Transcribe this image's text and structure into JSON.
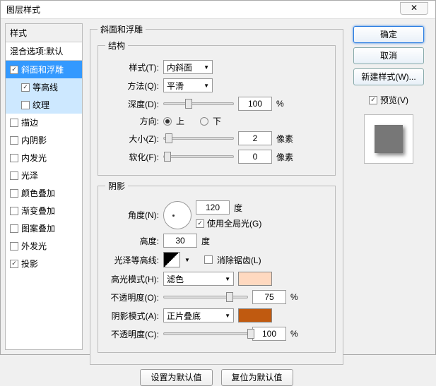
{
  "title": "图层样式",
  "left": {
    "header": "样式",
    "sub": "混合选项:默认",
    "items": [
      {
        "label": "斜面和浮雕",
        "checked": true,
        "selected": "sel"
      },
      {
        "label": "等高线",
        "checked": true,
        "indent": true,
        "selected": "sub-sel"
      },
      {
        "label": "纹理",
        "checked": false,
        "indent": true,
        "selected": "sub-sel"
      },
      {
        "label": "描边",
        "checked": false
      },
      {
        "label": "内阴影",
        "checked": false
      },
      {
        "label": "内发光",
        "checked": false
      },
      {
        "label": "光泽",
        "checked": false
      },
      {
        "label": "颜色叠加",
        "checked": false
      },
      {
        "label": "渐变叠加",
        "checked": false
      },
      {
        "label": "图案叠加",
        "checked": false
      },
      {
        "label": "外发光",
        "checked": false
      },
      {
        "label": "投影",
        "checked": true
      }
    ]
  },
  "group1_title": "斜面和浮雕",
  "struct": {
    "title": "结构",
    "style_lbl": "样式(T):",
    "style_val": "内斜面",
    "method_lbl": "方法(Q):",
    "method_val": "平滑",
    "depth_lbl": "深度(D):",
    "depth_val": "100",
    "depth_unit": "%",
    "dir_lbl": "方向:",
    "dir_up": "上",
    "dir_down": "下",
    "size_lbl": "大小(Z):",
    "size_val": "2",
    "size_unit": "像素",
    "soft_lbl": "软化(F):",
    "soft_val": "0",
    "soft_unit": "像素"
  },
  "shade": {
    "title": "阴影",
    "angle_lbl": "角度(N):",
    "angle_val": "120",
    "angle_unit": "度",
    "global": "使用全局光(G)",
    "alt_lbl": "高度:",
    "alt_val": "30",
    "alt_unit": "度",
    "gloss_lbl": "光泽等高线:",
    "aa": "消除锯齿(L)",
    "hl_mode_lbl": "高光模式(H):",
    "hl_mode_val": "滤色",
    "hl_color": "#ffd9c0",
    "hl_op_lbl": "不透明度(O):",
    "hl_op_val": "75",
    "pct": "%",
    "sh_mode_lbl": "阴影模式(A):",
    "sh_mode_val": "正片叠底",
    "sh_color": "#c05a10",
    "sh_op_lbl": "不透明度(C):",
    "sh_op_val": "100"
  },
  "bottom": {
    "default": "设置为默认值",
    "reset": "复位为默认值"
  },
  "right": {
    "ok": "确定",
    "cancel": "取消",
    "newstyle": "新建样式(W)...",
    "preview": "预览(V)"
  }
}
